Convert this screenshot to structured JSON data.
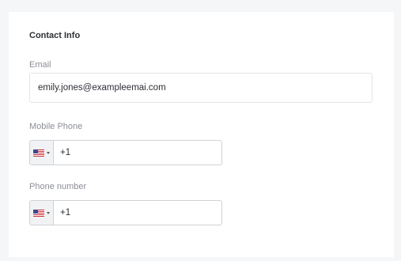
{
  "contact_info": {
    "title": "Contact Info",
    "email": {
      "label": "Email",
      "value": "emily.jones@exampleemai.com"
    },
    "mobile_phone": {
      "label": "Mobile Phone",
      "country_flag_icon": "us-flag-icon",
      "value": "+1"
    },
    "phone_number": {
      "label": "Phone number",
      "country_flag_icon": "us-flag-icon",
      "value": "+1"
    }
  }
}
